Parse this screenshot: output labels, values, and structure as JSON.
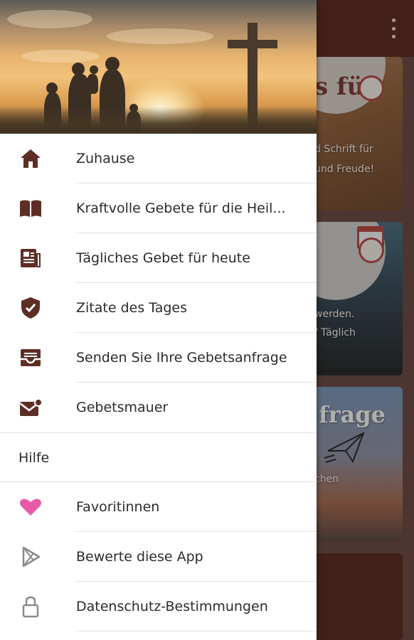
{
  "drawer": {
    "items": [
      {
        "label": "Zuhause",
        "icon": "home-icon"
      },
      {
        "label": "Kraftvolle Gebete für die Heil...",
        "icon": "book-icon"
      },
      {
        "label": "Tägliches Gebet für heute",
        "icon": "newspaper-icon"
      },
      {
        "label": "Zitate des Tages",
        "icon": "shield-check-icon"
      },
      {
        "label": "Senden Sie Ihre Gebetsanfrage",
        "icon": "inbox-icon"
      },
      {
        "label": "Gebetsmauer",
        "icon": "mail-notification-icon"
      }
    ],
    "section_label": "Hilfe",
    "help_items": [
      {
        "label": "Favoritinnen",
        "icon": "heart-icon"
      },
      {
        "label": "Bewerte diese App",
        "icon": "play-store-icon"
      },
      {
        "label": "Datenschutz-Bestimmungen",
        "icon": "lock-icon"
      }
    ]
  },
  "background": {
    "card1": {
      "title_fragment": "s für",
      "line1": "d Schrift für",
      "line2": "und Freude!"
    },
    "card2": {
      "line1": "werden.",
      "line2": "/ Täglich"
    },
    "card3": {
      "title_fragment": "frage",
      "line1": "chen"
    }
  },
  "colors": {
    "app_bar": "#5d2e25",
    "icon_brown": "#5d2e25",
    "heart_pink": "#e85aa6",
    "icon_gray": "#8a8a8a"
  }
}
